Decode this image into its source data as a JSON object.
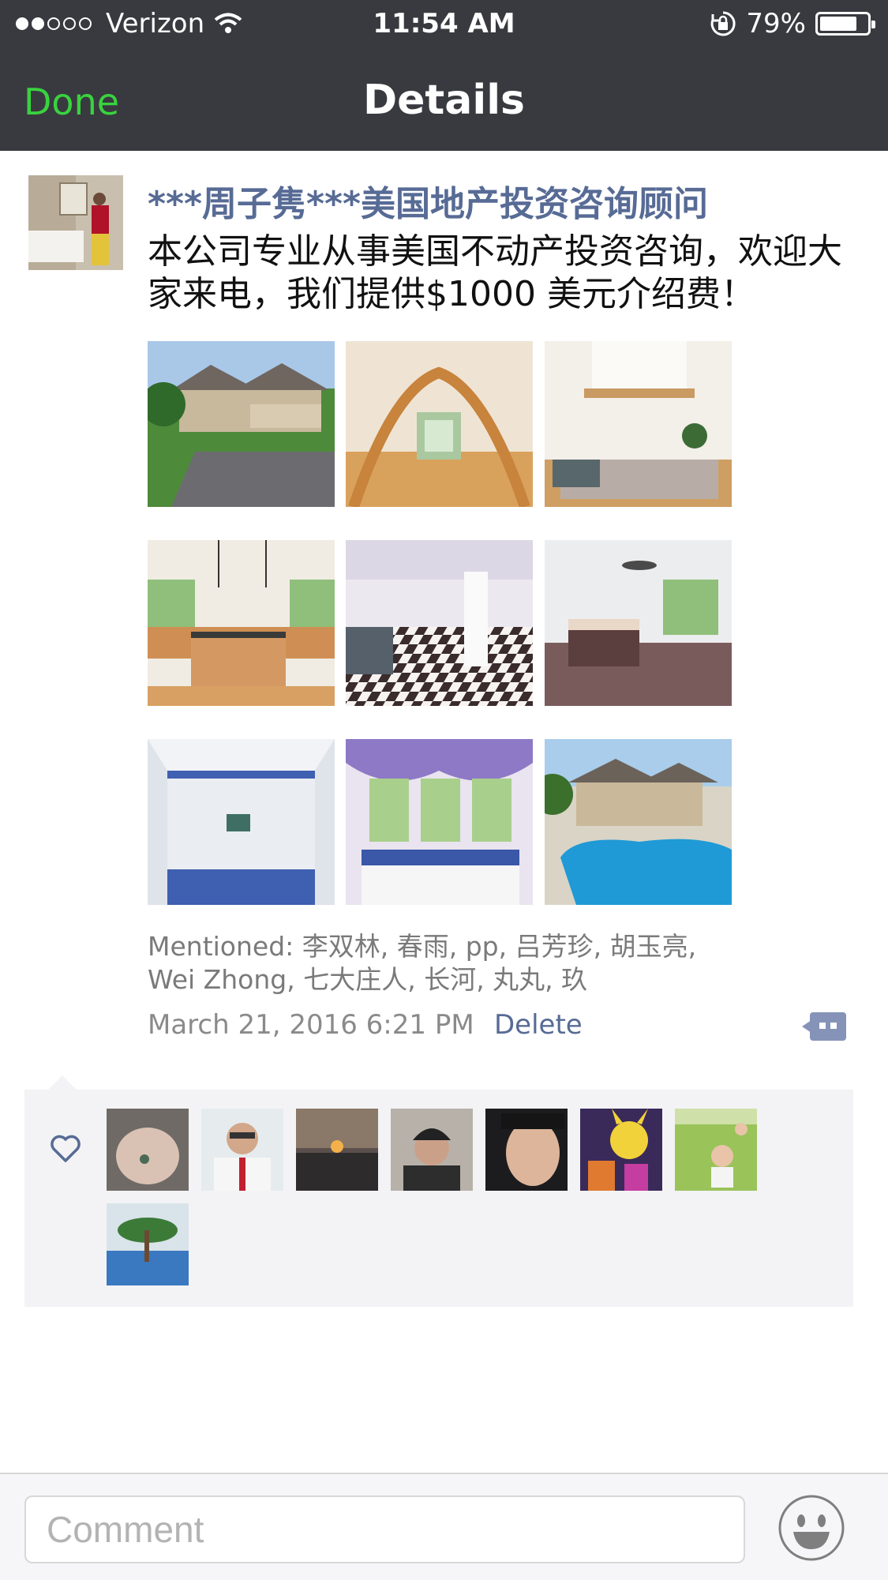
{
  "status_bar": {
    "carrier": "Verizon",
    "signal_dots_filled": 2,
    "signal_dots_total": 5,
    "time": "11:54 AM",
    "battery": "79%",
    "battery_level": 0.79
  },
  "nav": {
    "done_label": "Done",
    "title": "Details",
    "done_color": "#39d33f"
  },
  "post": {
    "username": "***周子隽***美国地产投资咨询顾问",
    "text": "本公司专业从事美国不动产投资咨询，欢迎大家来电，我们提供$1000 美元介绍费！",
    "images": [
      {
        "icon": "house-exterior-photo"
      },
      {
        "icon": "staircase-foyer-photo"
      },
      {
        "icon": "living-room-loft-photo"
      },
      {
        "icon": "kitchen-photo"
      },
      {
        "icon": "checkered-floor-basement-photo"
      },
      {
        "icon": "bedroom-photo"
      },
      {
        "icon": "shower-bathroom-photo"
      },
      {
        "icon": "bathtub-photo"
      },
      {
        "icon": "pool-photo"
      }
    ],
    "mentioned": "Mentioned: 李双林, 春雨, pp, 吕芳珍, 胡玉亮, Wei Zhong, 七大庄人, 长河, 丸丸, 玖",
    "timestamp": "March 21, 2016 6:21 PM",
    "delete_label": "Delete",
    "link_color": "#576b95"
  },
  "likes": {
    "icon": "heart-outline-icon",
    "avatars": [
      {
        "icon": "hands-tattoo-avatar"
      },
      {
        "icon": "man-in-suit-avatar"
      },
      {
        "icon": "sunset-avatar"
      },
      {
        "icon": "man-in-cap-avatar"
      },
      {
        "icon": "man-selfie-avatar"
      },
      {
        "icon": "pikachu-avatar"
      },
      {
        "icon": "kids-on-grass-avatar"
      },
      {
        "icon": "bonsai-avatar"
      }
    ]
  },
  "comment_bar": {
    "placeholder": "Comment",
    "emoji_icon": "smiley-face-icon"
  }
}
